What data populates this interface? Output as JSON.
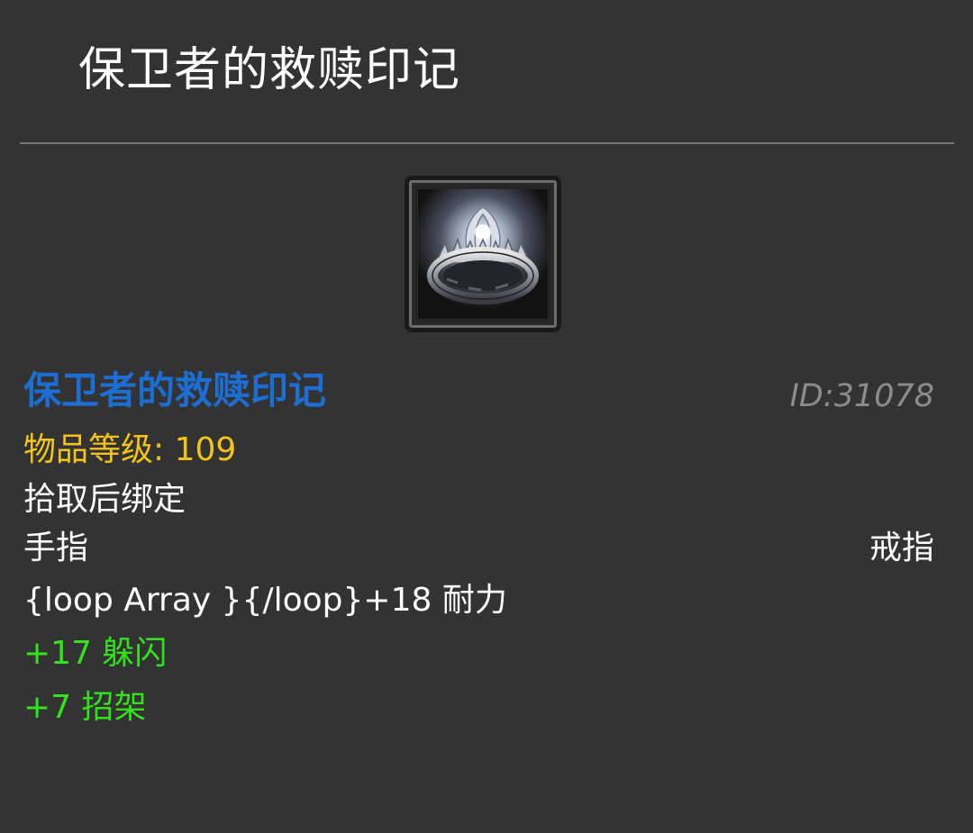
{
  "header": {
    "title": "保卫者的救赎印记"
  },
  "item": {
    "icon": "ring-icon",
    "name": "保卫者的救赎印记",
    "name_color": "#1d6ed2",
    "id_text": "ID:31078",
    "item_level_text": "物品等级: 109",
    "item_level_color": "#f2c31b",
    "bind_text": "拾取后绑定",
    "slot_left": "手指",
    "slot_right": "戒指",
    "stamina_text": "{loop Array }{/loop}+18 耐力",
    "bonus_color": "#32e21c",
    "bonus_stats": [
      "+17 躲闪",
      "+7 招架"
    ]
  }
}
